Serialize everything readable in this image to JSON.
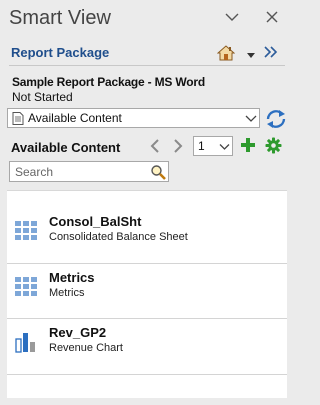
{
  "panel": {
    "title": "Smart View"
  },
  "header": {
    "link": "Report Package",
    "package_name": "Sample Report Package - MS Word",
    "package_status": "Not Started"
  },
  "selector": {
    "value": "Available Content"
  },
  "content": {
    "title": "Available Content",
    "page": "1",
    "search_placeholder": "Search",
    "items": [
      {
        "name": "Consol_BalSht",
        "description": "Consolidated Balance Sheet",
        "icon": "grid-report-icon"
      },
      {
        "name": "Metrics",
        "description": "Metrics",
        "icon": "grid-report-icon"
      },
      {
        "name": "Rev_GP2",
        "description": "Revenue Chart",
        "icon": "bar-chart-icon"
      }
    ]
  },
  "colors": {
    "link": "#1f4e8c",
    "accent_green": "#2e9a2e",
    "accent_blue": "#2c6fc0",
    "background": "#ebebeb"
  }
}
